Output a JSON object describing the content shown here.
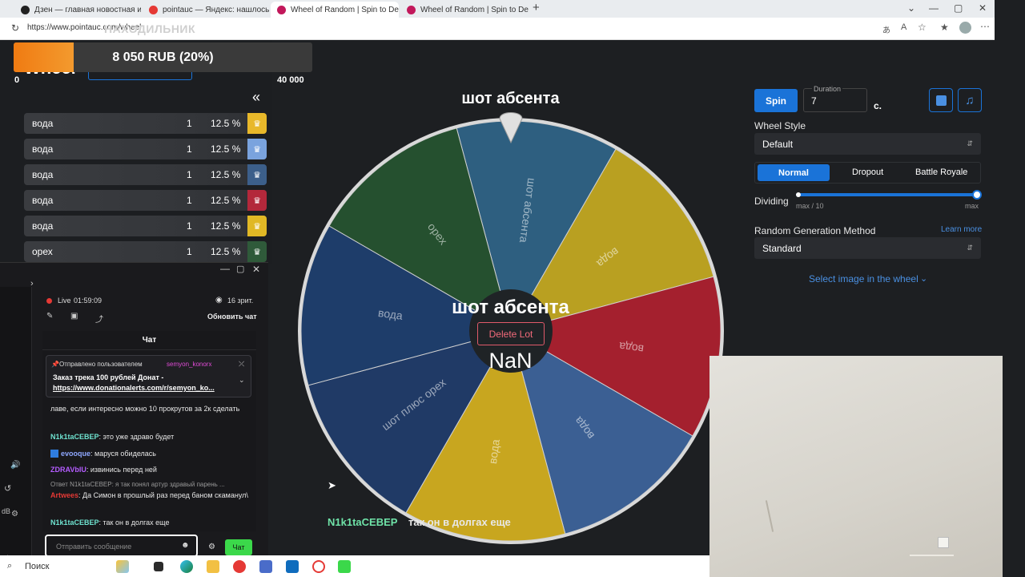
{
  "browser": {
    "tabs": [
      {
        "label": "Дзен — главная новостная инф",
        "color": "#222222"
      },
      {
        "label": "pointauc — Яндекс: нашлось 3 т",
        "color": "#e53935"
      },
      {
        "label": "Wheel of Random | Spin to Decid",
        "color": "#c2185b"
      },
      {
        "label": "Wheel of Random | Spin to Decid",
        "color": "#c2185b"
      }
    ],
    "url": "https://www.pointauc.com/wheel"
  },
  "overlay": {
    "goal_title": "НАХОДИЛЬНИК",
    "progress_text": "8 050 RUB (20%)",
    "progress_fraction": 0.2,
    "min": "0",
    "max": "40 000",
    "partial_heading": "Wheel"
  },
  "lots": [
    {
      "name": "вода",
      "count": "1",
      "percent": "12.5 %",
      "color": "#e8b82a"
    },
    {
      "name": "вода",
      "count": "1",
      "percent": "12.5 %",
      "color": "#7aa3de"
    },
    {
      "name": "вода",
      "count": "1",
      "percent": "12.5 %",
      "color": "#3c5f8a"
    },
    {
      "name": "вода",
      "count": "1",
      "percent": "12.5 %",
      "color": "#b3283b"
    },
    {
      "name": "вода",
      "count": "1",
      "percent": "12.5 %",
      "color": "#e0b825"
    },
    {
      "name": "орех",
      "count": "1",
      "percent": "12.5 %",
      "color": "#2f5a3a"
    }
  ],
  "collapse_icon": "«",
  "wheel": {
    "winner_title": "шот абсента",
    "center_title": "шот абсента",
    "delete_label": "Delete Lot",
    "center_value": "NaN",
    "segments": [
      {
        "label": "шот абсента",
        "color": "#2e5f80"
      },
      {
        "label": "вода",
        "color": "#b9a021"
      },
      {
        "label": "вода",
        "color": "#a4202e"
      },
      {
        "label": "вода",
        "color": "#3b5f93"
      },
      {
        "label": "вода",
        "color": "#c8a61f"
      },
      {
        "label": "шот плюс орех",
        "color": "#203a66"
      },
      {
        "label": "вода",
        "color": "#1e3d6a"
      },
      {
        "label": "орех",
        "color": "#25502f"
      }
    ]
  },
  "controls": {
    "spin_label": "Spin",
    "duration_label": "Duration",
    "duration_value": "7",
    "duration_unit": "с.",
    "wheel_style_label": "Wheel Style",
    "wheel_style_value": "Default",
    "modes": [
      "Normal",
      "Dropout",
      "Battle Royale"
    ],
    "dividing_label": "Dividing",
    "dividing_min": "max / 10",
    "dividing_max": "max",
    "dividing_fraction": 1.0,
    "rng_label": "Random Generation Method",
    "learn_more": "Learn more",
    "rng_value": "Standard",
    "select_image": "Select image in the wheel"
  },
  "chat": {
    "live": "Live",
    "time": "01:59:09",
    "viewers": "16 зрит.",
    "refresh": "Обновить чат",
    "chat_label": "Чат",
    "pinned_by": "Отправлено пользователем",
    "pinned_user": "semyon_konorx",
    "pinned_text": "Заказ трека 100 рублей Донат -",
    "pinned_link": "https://www.donationalerts.com/r/semyon_ko...",
    "msg1": "лаве, если интересно можно 10 прокрутов за 2к сделать",
    "m2_nick": "N1k1taCEBEP",
    "m2_text": ": это уже здраво будет",
    "m3_nick": "evooque",
    "m3_text": ": маруся обиделась",
    "m4_nick": "ZDRAVbIU",
    "m4_text": ": извинись перед ней",
    "m5_reply": "Ответ N1k1taCEBEP: я так понял артур здравый парень ...",
    "m5_nick": "Artwees",
    "m5_text": ": Да Симон в прошлый раз перед баном скаманул\\",
    "m6_nick": "N1k1taCEBEP",
    "m6_text": ": так он в долгах еще",
    "input_placeholder": "Отправить сообщение",
    "send": "Чат"
  },
  "overlay_chat": {
    "nick": "N1k1taCEBEP",
    "text": "так он в долгах еще"
  },
  "taskbar": {
    "search": "Поиск"
  },
  "side_labels": {
    "db": "dB"
  }
}
